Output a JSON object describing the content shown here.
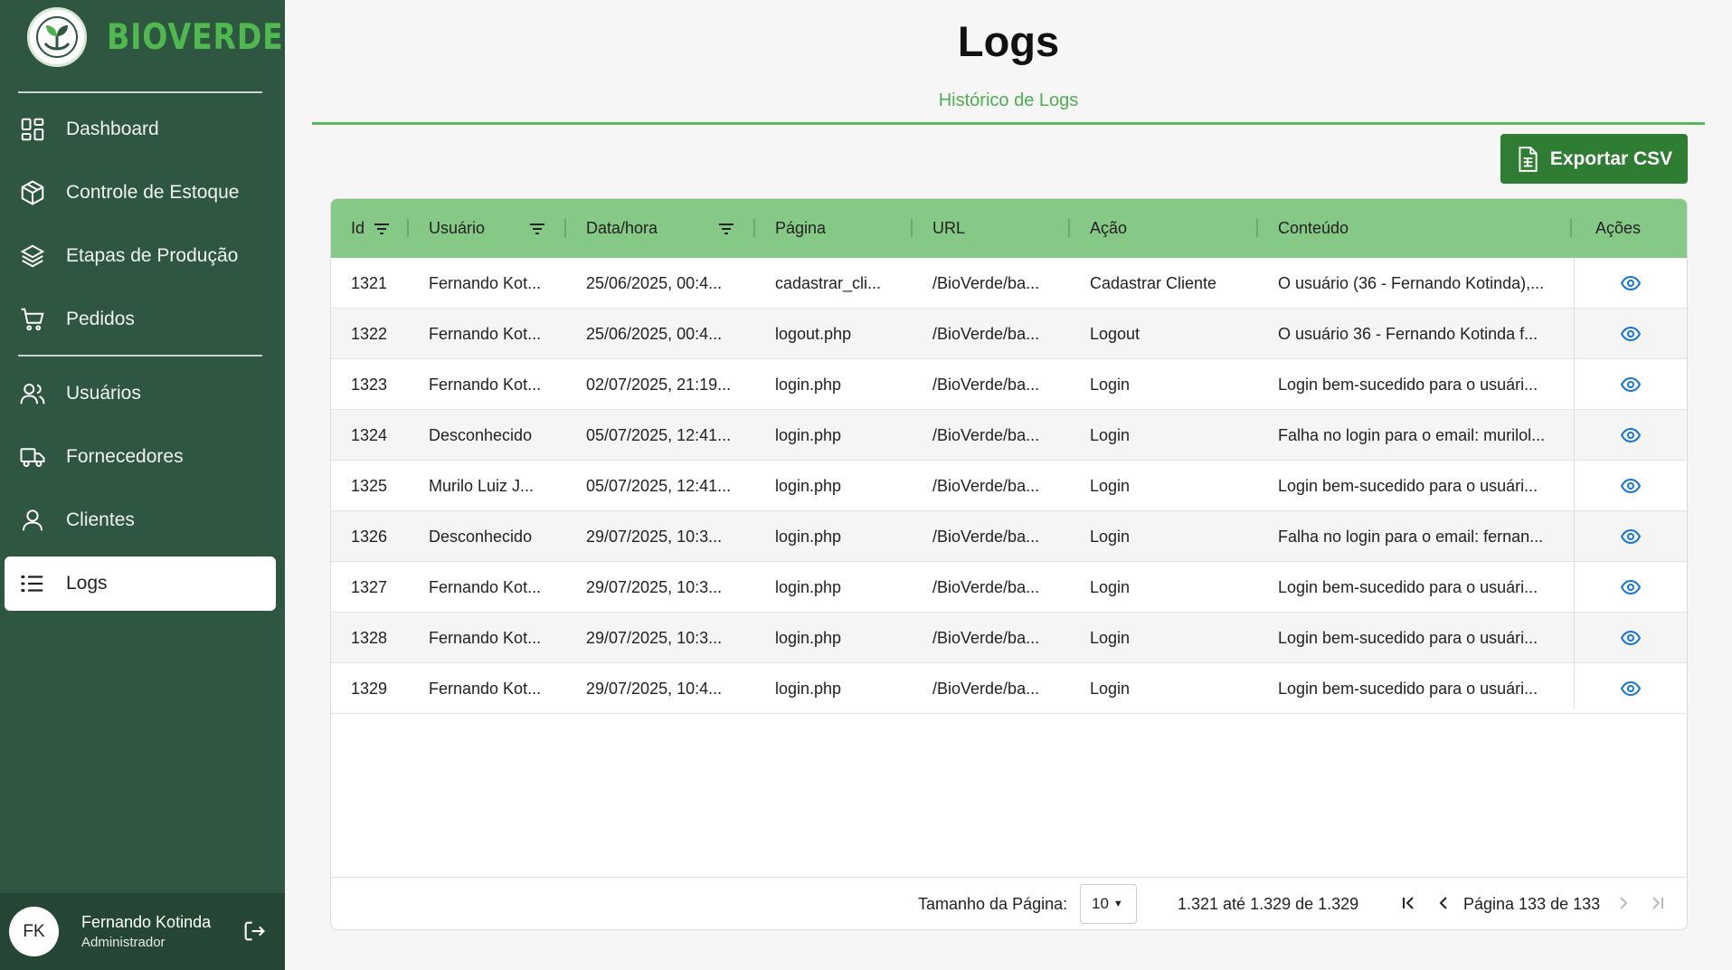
{
  "brand": {
    "name": "BIOVERDE"
  },
  "nav": {
    "items": [
      {
        "label": "Dashboard",
        "icon": "dashboard-icon"
      },
      {
        "label": "Controle de Estoque",
        "icon": "box-icon"
      },
      {
        "label": "Etapas de Produção",
        "icon": "layers-icon"
      },
      {
        "label": "Pedidos",
        "icon": "cart-icon"
      },
      {
        "label": "Usuários",
        "icon": "users-icon"
      },
      {
        "label": "Fornecedores",
        "icon": "truck-icon"
      },
      {
        "label": "Clientes",
        "icon": "user-icon"
      },
      {
        "label": "Logs",
        "icon": "list-icon",
        "active": true
      }
    ]
  },
  "user": {
    "initials": "FK",
    "name": "Fernando Kotinda",
    "role": "Administrador"
  },
  "page": {
    "title": "Logs",
    "subtitle": "Histórico de Logs",
    "export_label": "Exportar CSV"
  },
  "table": {
    "columns": [
      "Id",
      "Usuário",
      "Data/hora",
      "Página",
      "URL",
      "Ação",
      "Conteúdo",
      "Ações"
    ],
    "rows": [
      [
        "1321",
        "Fernando Kot...",
        "25/06/2025, 00:4...",
        "cadastrar_cli...",
        "/BioVerde/ba...",
        "Cadastrar Cliente",
        "O usuário (36 - Fernando Kotinda),..."
      ],
      [
        "1322",
        "Fernando Kot...",
        "25/06/2025, 00:4...",
        "logout.php",
        "/BioVerde/ba...",
        "Logout",
        "O usuário 36 - Fernando Kotinda f..."
      ],
      [
        "1323",
        "Fernando Kot...",
        "02/07/2025, 21:19...",
        "login.php",
        "/BioVerde/ba...",
        "Login",
        "Login bem-sucedido para o usuári..."
      ],
      [
        "1324",
        "Desconhecido",
        "05/07/2025, 12:41...",
        "login.php",
        "/BioVerde/ba...",
        "Login",
        "Falha no login para o email: murilol..."
      ],
      [
        "1325",
        "Murilo Luiz J...",
        "05/07/2025, 12:41...",
        "login.php",
        "/BioVerde/ba...",
        "Login",
        "Login bem-sucedido para o usuári..."
      ],
      [
        "1326",
        "Desconhecido",
        "29/07/2025, 10:3...",
        "login.php",
        "/BioVerde/ba...",
        "Login",
        "Falha no login para o email: fernan..."
      ],
      [
        "1327",
        "Fernando Kot...",
        "29/07/2025, 10:3...",
        "login.php",
        "/BioVerde/ba...",
        "Login",
        "Login bem-sucedido para o usuári..."
      ],
      [
        "1328",
        "Fernando Kot...",
        "29/07/2025, 10:3...",
        "login.php",
        "/BioVerde/ba...",
        "Login",
        "Login bem-sucedido para o usuári..."
      ],
      [
        "1329",
        "Fernando Kot...",
        "29/07/2025, 10:4...",
        "login.php",
        "/BioVerde/ba...",
        "Login",
        "Login bem-sucedido para o usuári..."
      ]
    ]
  },
  "pagination": {
    "page_size_label": "Tamanho da Página:",
    "page_size": "10",
    "range_text": "1.321 até 1.329 de 1.329",
    "page_text": "Página 133 de 133"
  },
  "colors": {
    "sidebar": "#2f5640",
    "accent": "#4caf50",
    "header": "#86c886",
    "button": "#2e7d32",
    "eye": "#1976d2"
  }
}
